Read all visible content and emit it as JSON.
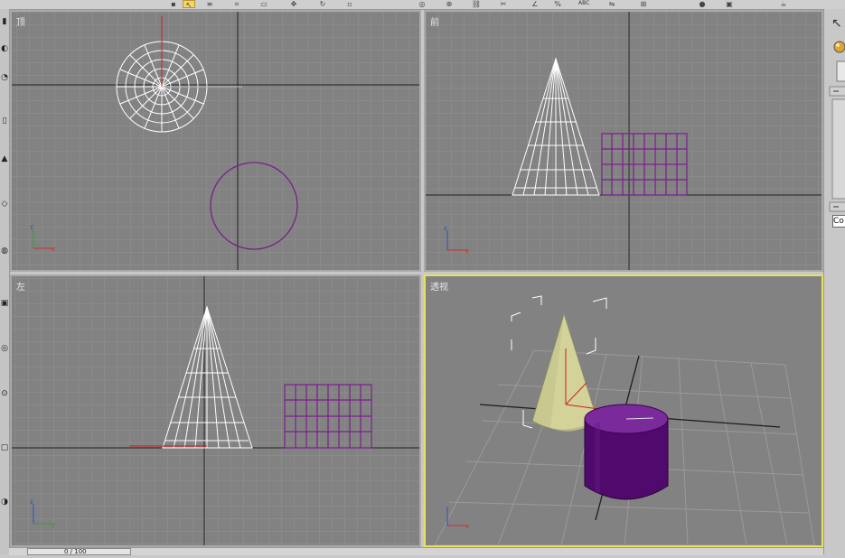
{
  "toolbar": {
    "abc_label": "ABC"
  },
  "viewports": {
    "top": {
      "label": "顶"
    },
    "front": {
      "label": "前"
    },
    "left": {
      "label": "左"
    },
    "perspective": {
      "label": "透视"
    }
  },
  "command_panel": {
    "name_field_value": "Co"
  },
  "status": {
    "frame_counter": "0 / 100"
  },
  "colors": {
    "viewport_bg": "#828282",
    "grid": "#929292",
    "wire_white": "#ffffff",
    "wire_purple": "#7a1f8a",
    "cone_fill": "#c8c890",
    "cylinder_fill": "#4f0a6b",
    "active_border": "#e8e05a"
  }
}
